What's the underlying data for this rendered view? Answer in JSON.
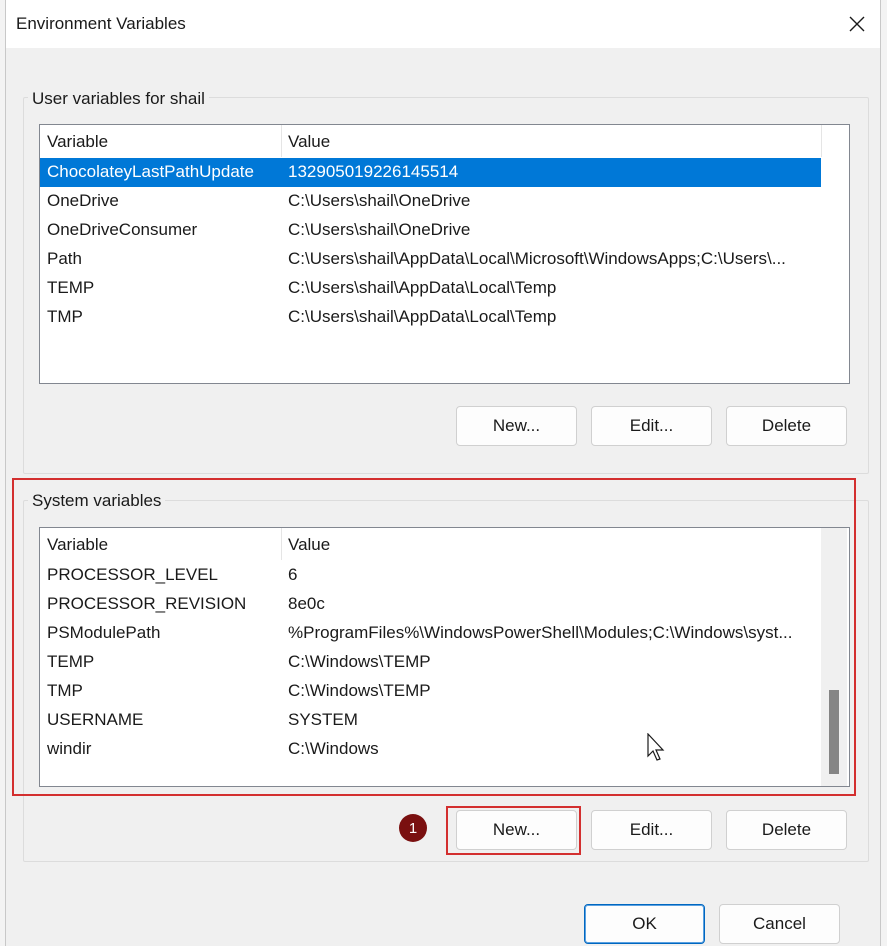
{
  "window": {
    "title": "Environment Variables"
  },
  "user_section": {
    "label": "User variables for shail",
    "columns": [
      "Variable",
      "Value"
    ],
    "rows": [
      {
        "variable": "ChocolateyLastPathUpdate",
        "value": "132905019226145514",
        "selected": true
      },
      {
        "variable": "OneDrive",
        "value": "C:\\Users\\shail\\OneDrive"
      },
      {
        "variable": "OneDriveConsumer",
        "value": "C:\\Users\\shail\\OneDrive"
      },
      {
        "variable": "Path",
        "value": "C:\\Users\\shail\\AppData\\Local\\Microsoft\\WindowsApps;C:\\Users\\..."
      },
      {
        "variable": "TEMP",
        "value": "C:\\Users\\shail\\AppData\\Local\\Temp"
      },
      {
        "variable": "TMP",
        "value": "C:\\Users\\shail\\AppData\\Local\\Temp"
      }
    ],
    "buttons": {
      "new": "New...",
      "edit": "Edit...",
      "delete": "Delete"
    }
  },
  "system_section": {
    "label": "System variables",
    "columns": [
      "Variable",
      "Value"
    ],
    "rows": [
      {
        "variable": "PROCESSOR_LEVEL",
        "value": "6"
      },
      {
        "variable": "PROCESSOR_REVISION",
        "value": "8e0c"
      },
      {
        "variable": "PSModulePath",
        "value": "%ProgramFiles%\\WindowsPowerShell\\Modules;C:\\Windows\\syst..."
      },
      {
        "variable": "TEMP",
        "value": "C:\\Windows\\TEMP"
      },
      {
        "variable": "TMP",
        "value": "C:\\Windows\\TEMP"
      },
      {
        "variable": "USERNAME",
        "value": "SYSTEM"
      },
      {
        "variable": "windir",
        "value": "C:\\Windows"
      }
    ],
    "scroll_position": 1.0,
    "buttons": {
      "new": "New...",
      "edit": "Edit...",
      "delete": "Delete"
    }
  },
  "dialog_buttons": {
    "ok": "OK",
    "cancel": "Cancel"
  },
  "annotation": {
    "step_badge": "1",
    "highlight_color": "#d32f2f",
    "badge_color": "#7a1010"
  },
  "colors": {
    "selection": "#0078d7",
    "dialog_bg": "#f0f0f0"
  },
  "icons": {
    "close": "close-icon",
    "cursor": "mouse-pointer-icon"
  }
}
